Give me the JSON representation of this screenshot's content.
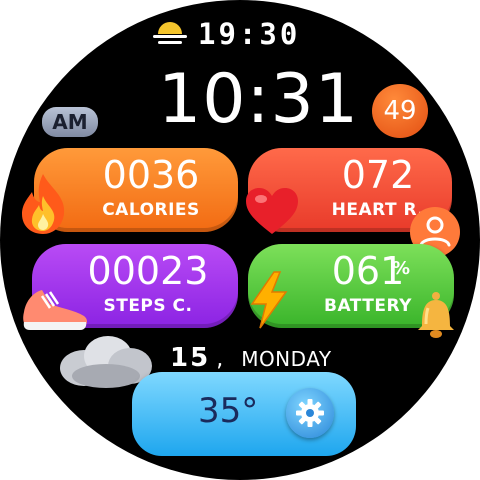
{
  "status": {
    "time": "19:30",
    "icon": "sunset-icon"
  },
  "clock": {
    "time": "10:31",
    "period": "AM"
  },
  "badge": {
    "value": "49"
  },
  "tiles": {
    "calories": {
      "value": "0036",
      "label": "CALORIES",
      "icon": "flame-icon",
      "color": "#f47a1f"
    },
    "heart": {
      "value": "072",
      "label": "HEART R.",
      "icon": "heart-icon",
      "color": "#ee4a33"
    },
    "steps": {
      "value": "00023",
      "label": "STEPS C.",
      "icon": "sneaker-icon",
      "color": "#9d34ea"
    },
    "battery": {
      "value": "061",
      "unit": "%",
      "label": "BATTERY",
      "icon": "lightning-icon",
      "color": "#4ec334"
    }
  },
  "date": {
    "day": "15",
    "separator": ",",
    "weekday": "MONDAY"
  },
  "weather": {
    "temperature": "35°",
    "icon": "cloud-icon"
  },
  "icons": {
    "profile": "profile-icon",
    "alarm": "bell-icon",
    "settings": "gear-icon"
  }
}
